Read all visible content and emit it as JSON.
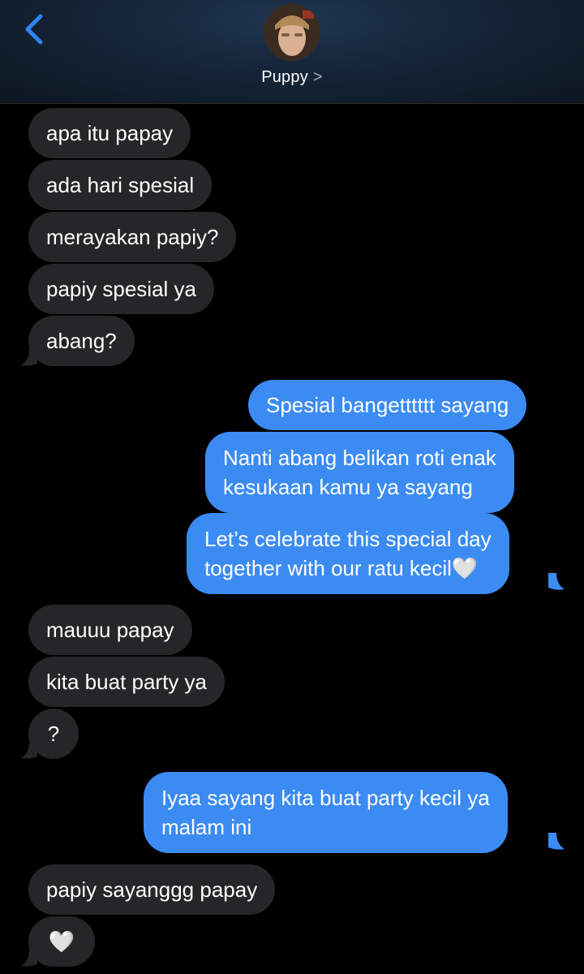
{
  "header": {
    "back_icon": "chevron-left-icon",
    "contact_name": "Puppy",
    "contact_chevron": ">",
    "accent": "#2c85f5"
  },
  "colors": {
    "incoming": "#262628",
    "outgoing": "#3b8bf3",
    "background": "#000000"
  },
  "messages": [
    {
      "from": "incoming",
      "text": "apa itu papay"
    },
    {
      "from": "incoming",
      "text": "ada hari spesial"
    },
    {
      "from": "incoming",
      "text": "merayakan papiy?"
    },
    {
      "from": "incoming",
      "text": "papiy spesial ya"
    },
    {
      "from": "incoming",
      "text": "abang?"
    },
    {
      "from": "outgoing",
      "text": "Spesial bangetttttt sayang"
    },
    {
      "from": "outgoing",
      "lines": [
        "Nanti abang belikan roti enak",
        "kesukaan kamu ya sayang"
      ]
    },
    {
      "from": "outgoing",
      "lines": [
        "Let’s celebrate this special day",
        "together with our ratu kecil🤍"
      ]
    },
    {
      "from": "incoming",
      "text": "mauuu papay"
    },
    {
      "from": "incoming",
      "text": "kita buat party ya"
    },
    {
      "from": "incoming",
      "text": "?"
    },
    {
      "from": "outgoing",
      "lines": [
        "Iyaa sayang kita buat party kecil ya",
        "malam ini"
      ]
    },
    {
      "from": "incoming",
      "text": "papiy sayanggg papay"
    },
    {
      "from": "incoming",
      "text": "🤍"
    }
  ]
}
